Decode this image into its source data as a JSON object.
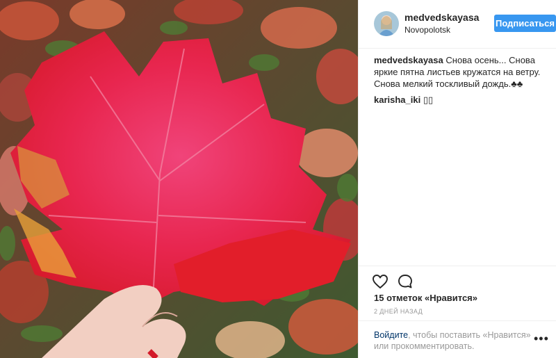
{
  "header": {
    "username": "medvedskayasa",
    "location": "Novopolotsk",
    "follow_label": "Подписаться"
  },
  "caption": {
    "username": "medvedskayasa",
    "text": "Снова осень... Снова яркие пятна листьев кружатся на ветру. Снова мелкий тоскливый дождь.♣♣"
  },
  "comments": [
    {
      "username": "karisha_iki",
      "text": "▯▯"
    }
  ],
  "actions": {
    "like_icon": "heart-icon",
    "comment_icon": "speech-bubble-icon",
    "likes_text": "15 отметок «Нравится»",
    "timestamp": "2 ДНЕЙ НАЗАД"
  },
  "login_prompt": {
    "link": "Войдите",
    "text": ", чтобы поставить «Нравится» или прокомментировать."
  },
  "more_label": "•••",
  "colors": {
    "accent": "#3897f0",
    "link": "#003569",
    "muted": "#999999",
    "text": "#262626"
  }
}
